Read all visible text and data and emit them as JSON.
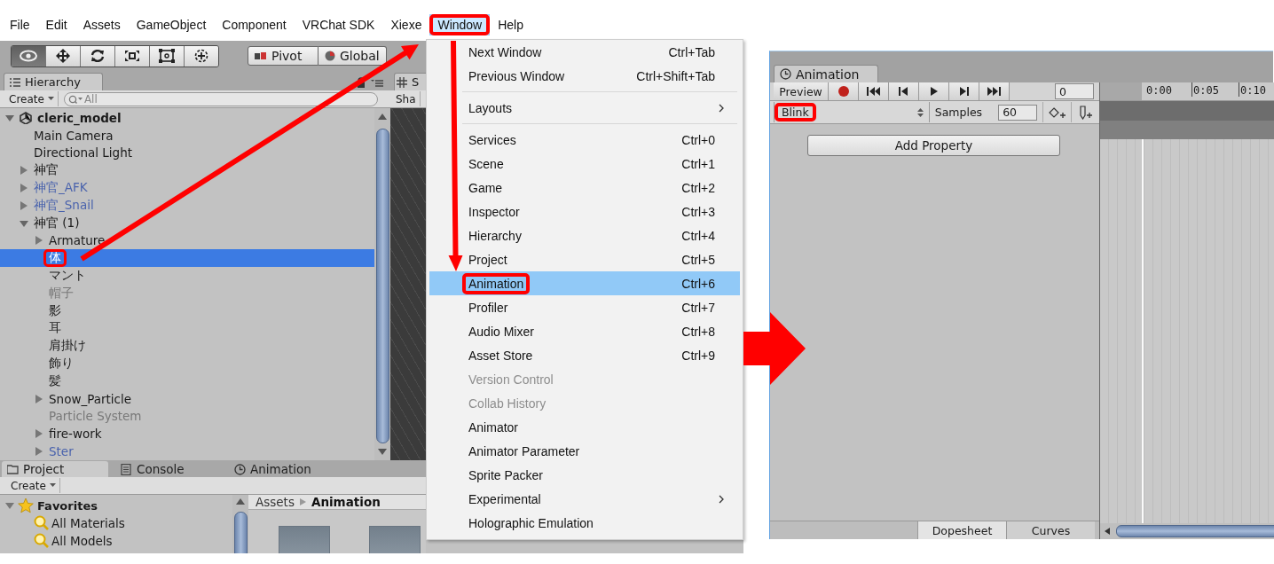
{
  "menu_bar": [
    {
      "label": "File",
      "selected": false,
      "highlighted": false
    },
    {
      "label": "Edit",
      "selected": false,
      "highlighted": false
    },
    {
      "label": "Assets",
      "selected": false,
      "highlighted": false
    },
    {
      "label": "GameObject",
      "selected": false,
      "highlighted": false
    },
    {
      "label": "Component",
      "selected": false,
      "highlighted": false
    },
    {
      "label": "VRChat SDK",
      "selected": false,
      "highlighted": false
    },
    {
      "label": "Xiexe",
      "selected": false,
      "highlighted": false
    },
    {
      "label": "Window",
      "selected": true,
      "highlighted": true
    },
    {
      "label": "Help",
      "selected": false,
      "highlighted": false
    }
  ],
  "toolbar": {
    "tools": [
      {
        "kind": "view",
        "selected": true
      },
      {
        "kind": "move",
        "selected": false
      },
      {
        "kind": "rotate",
        "selected": false
      },
      {
        "kind": "scale",
        "selected": false
      },
      {
        "kind": "rect",
        "selected": false
      },
      {
        "kind": "transform",
        "selected": false
      }
    ],
    "pivot": "Pivot",
    "global": "Global"
  },
  "hierarchy": {
    "tab": "Hierarchy",
    "create": "Create",
    "search_placeholder": "All",
    "items": [
      {
        "label": "cleric_model",
        "kind": "scene",
        "expanded": true,
        "selected": false,
        "highlighted": false,
        "children": [
          {
            "label": "Main Camera",
            "kind": "object",
            "selected": false,
            "highlighted": false
          },
          {
            "label": "Directional Light",
            "kind": "object",
            "selected": false,
            "highlighted": false
          },
          {
            "label": "神官",
            "kind": "object",
            "expanded": false,
            "selected": false,
            "highlighted": false
          },
          {
            "label": "神官_AFK",
            "kind": "prefab",
            "expanded": false,
            "selected": false,
            "highlighted": false
          },
          {
            "label": "神官_Snail",
            "kind": "prefab",
            "expanded": false,
            "selected": false,
            "highlighted": false
          },
          {
            "label": "神官 (1)",
            "kind": "object",
            "expanded": true,
            "selected": false,
            "highlighted": false,
            "children": [
              {
                "label": "Armature",
                "kind": "object",
                "expanded": false,
                "selected": false,
                "highlighted": false
              },
              {
                "label": "体",
                "kind": "object",
                "selected": true,
                "highlighted": true
              },
              {
                "label": "マント",
                "kind": "object",
                "selected": false,
                "highlighted": false
              },
              {
                "label": "帽子",
                "kind": "inactive",
                "selected": false,
                "highlighted": false
              },
              {
                "label": "影",
                "kind": "object",
                "selected": false,
                "highlighted": false
              },
              {
                "label": "耳",
                "kind": "object",
                "selected": false,
                "highlighted": false
              },
              {
                "label": "肩掛け",
                "kind": "object",
                "selected": false,
                "highlighted": false
              },
              {
                "label": "飾り",
                "kind": "object",
                "selected": false,
                "highlighted": false
              },
              {
                "label": "髪",
                "kind": "object",
                "selected": false,
                "highlighted": false
              },
              {
                "label": "Snow_Particle",
                "kind": "object",
                "expanded": false,
                "selected": false,
                "highlighted": false
              },
              {
                "label": "Particle System",
                "kind": "inactive",
                "selected": false,
                "highlighted": false
              },
              {
                "label": "fire-work",
                "kind": "object",
                "expanded": false,
                "selected": false,
                "highlighted": false
              },
              {
                "label": "Ster",
                "kind": "prefab",
                "expanded": false,
                "selected": false,
                "highlighted": false
              }
            ]
          }
        ]
      }
    ]
  },
  "scene_panel": {
    "tab": "S",
    "toolbar": "Sha"
  },
  "bottom_panel": {
    "tabs": [
      {
        "label": "Project",
        "kind": "project",
        "selected": true
      },
      {
        "label": "Console",
        "kind": "console",
        "selected": false
      },
      {
        "label": "Animation",
        "kind": "animation",
        "selected": false
      }
    ],
    "create": "Create",
    "favorites": {
      "label": "Favorites",
      "expanded": true,
      "items": [
        "All Materials",
        "All Models"
      ]
    },
    "breadcrumb": [
      "Assets",
      "Animation"
    ]
  },
  "window_menu": {
    "items": [
      {
        "kind": "item",
        "label": "Next Window",
        "shortcut": "Ctrl+Tab",
        "disabled": false,
        "submenu": false,
        "selected": false,
        "highlighted": false
      },
      {
        "kind": "item",
        "label": "Previous Window",
        "shortcut": "Ctrl+Shift+Tab",
        "disabled": false,
        "submenu": false,
        "selected": false,
        "highlighted": false
      },
      {
        "kind": "separator"
      },
      {
        "kind": "item",
        "label": "Layouts",
        "disabled": false,
        "submenu": true,
        "selected": false,
        "highlighted": false
      },
      {
        "kind": "separator"
      },
      {
        "kind": "item",
        "label": "Services",
        "shortcut": "Ctrl+0",
        "disabled": false,
        "submenu": false,
        "selected": false,
        "highlighted": false
      },
      {
        "kind": "item",
        "label": "Scene",
        "shortcut": "Ctrl+1",
        "disabled": false,
        "submenu": false,
        "selected": false,
        "highlighted": false
      },
      {
        "kind": "item",
        "label": "Game",
        "shortcut": "Ctrl+2",
        "disabled": false,
        "submenu": false,
        "selected": false,
        "highlighted": false
      },
      {
        "kind": "item",
        "label": "Inspector",
        "shortcut": "Ctrl+3",
        "disabled": false,
        "submenu": false,
        "selected": false,
        "highlighted": false
      },
      {
        "kind": "item",
        "label": "Hierarchy",
        "shortcut": "Ctrl+4",
        "disabled": false,
        "submenu": false,
        "selected": false,
        "highlighted": false
      },
      {
        "kind": "item",
        "label": "Project",
        "shortcut": "Ctrl+5",
        "disabled": false,
        "submenu": false,
        "selected": false,
        "highlighted": false
      },
      {
        "kind": "item",
        "label": "Animation",
        "shortcut": "Ctrl+6",
        "disabled": false,
        "submenu": false,
        "selected": true,
        "highlighted": true
      },
      {
        "kind": "item",
        "label": "Profiler",
        "shortcut": "Ctrl+7",
        "disabled": false,
        "submenu": false,
        "selected": false,
        "highlighted": false
      },
      {
        "kind": "item",
        "label": "Audio Mixer",
        "shortcut": "Ctrl+8",
        "disabled": false,
        "submenu": false,
        "selected": false,
        "highlighted": false
      },
      {
        "kind": "item",
        "label": "Asset Store",
        "shortcut": "Ctrl+9",
        "disabled": false,
        "submenu": false,
        "selected": false,
        "highlighted": false
      },
      {
        "kind": "item",
        "label": "Version Control",
        "disabled": true,
        "submenu": false,
        "selected": false,
        "highlighted": false
      },
      {
        "kind": "item",
        "label": "Collab History",
        "disabled": true,
        "submenu": false,
        "selected": false,
        "highlighted": false
      },
      {
        "kind": "item",
        "label": "Animator",
        "disabled": false,
        "submenu": false,
        "selected": false,
        "highlighted": false
      },
      {
        "kind": "item",
        "label": "Animator Parameter",
        "disabled": false,
        "submenu": false,
        "selected": false,
        "highlighted": false
      },
      {
        "kind": "item",
        "label": "Sprite Packer",
        "disabled": false,
        "submenu": false,
        "selected": false,
        "highlighted": false
      },
      {
        "kind": "item",
        "label": "Experimental",
        "disabled": false,
        "submenu": true,
        "selected": false,
        "highlighted": false
      },
      {
        "kind": "item",
        "label": "Holographic Emulation",
        "disabled": false,
        "submenu": false,
        "selected": false,
        "highlighted": false
      }
    ]
  },
  "animation_window": {
    "tab": "Animation",
    "preview": "Preview",
    "frame": "0",
    "clip": {
      "label": "Blink",
      "highlighted": true
    },
    "samples_label": "Samples",
    "samples": "60",
    "add_property": "Add Property",
    "ruler": [
      "0:00",
      "0:05",
      "0:10"
    ],
    "view_tabs": [
      {
        "label": "Dopesheet",
        "selected": true
      },
      {
        "label": "Curves",
        "selected": false
      }
    ]
  }
}
